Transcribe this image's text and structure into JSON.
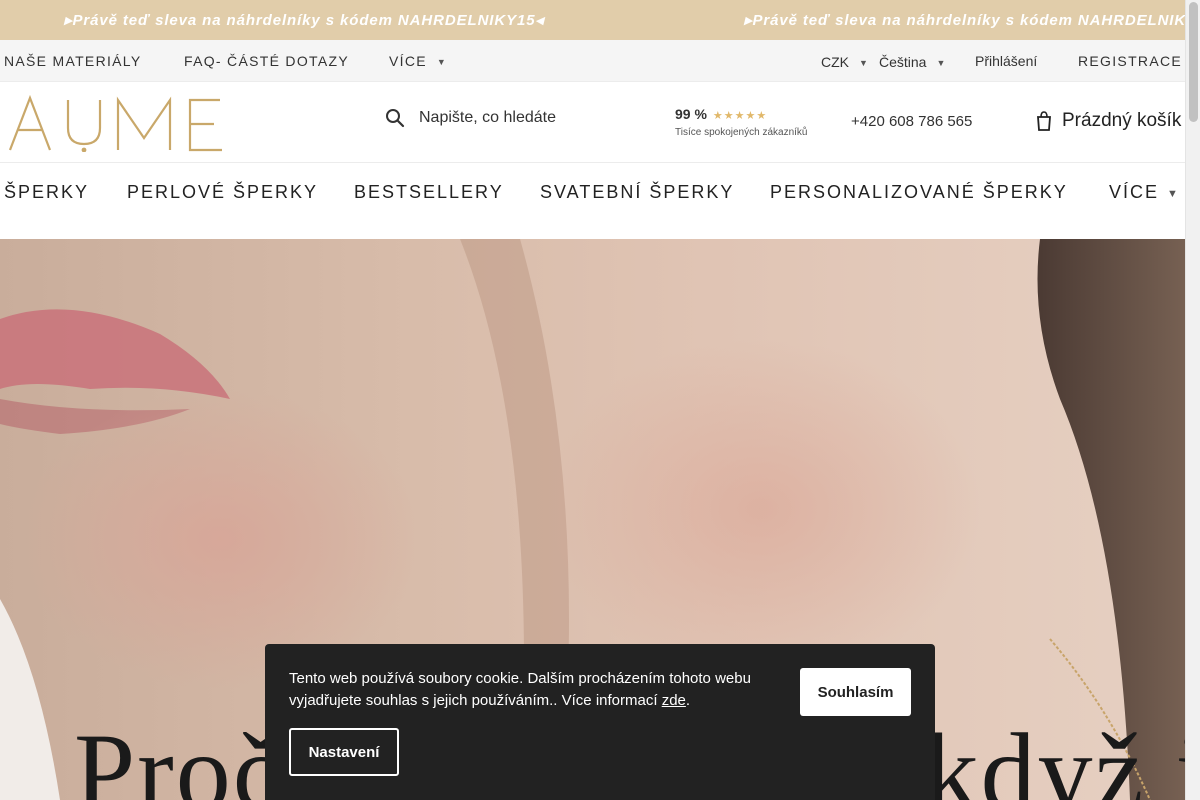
{
  "promo": {
    "text_a": "Právě teď sleva na náhrdelníky s kódem NAHRDELNIKY15",
    "text_b": "Právě teď sleva na náhrdelníky s kódem NAHRDELNIK",
    "background": "#e1cdaa"
  },
  "topbar": {
    "links": [
      "NAŠE MATERIÁLY",
      "FAQ- ČÁSTÉ DOTAZY",
      "VÍCE"
    ],
    "currency": "CZK",
    "language": "Čeština",
    "login": "Přihlášení",
    "register": "REGISTRACE"
  },
  "header": {
    "logo": "AUME",
    "search_placeholder": "Napište, co hledáte",
    "rating_percent": "99 %",
    "rating_stars": 5,
    "rating_caption": "Tisíce spokojených zákazníků",
    "phone": "+420 608 786 565",
    "cart": "Prázdný košík",
    "logo_color": "#c9a86a"
  },
  "nav": {
    "items": [
      "ŠPERKY",
      "PERLOVÉ ŠPERKY",
      "BESTSELLERY",
      "SVATEBNÍ ŠPERKY",
      "PERSONALIZOVANÉ ŠPERKY",
      "VÍCE"
    ]
  },
  "hero": {
    "title": "Proč nosit šperky, když je nemůžíš"
  },
  "cookie": {
    "message": "Tento web používá soubory cookie. Dalším procházením tohoto webu vyjadřujete souhlas s jejich používáním.. Více informací",
    "link": "zde",
    "accept": "Souhlasím",
    "settings": "Nastavení"
  },
  "icons": [
    "search-icon",
    "cart-icon",
    "star-icon",
    "chevron-down-icon"
  ]
}
